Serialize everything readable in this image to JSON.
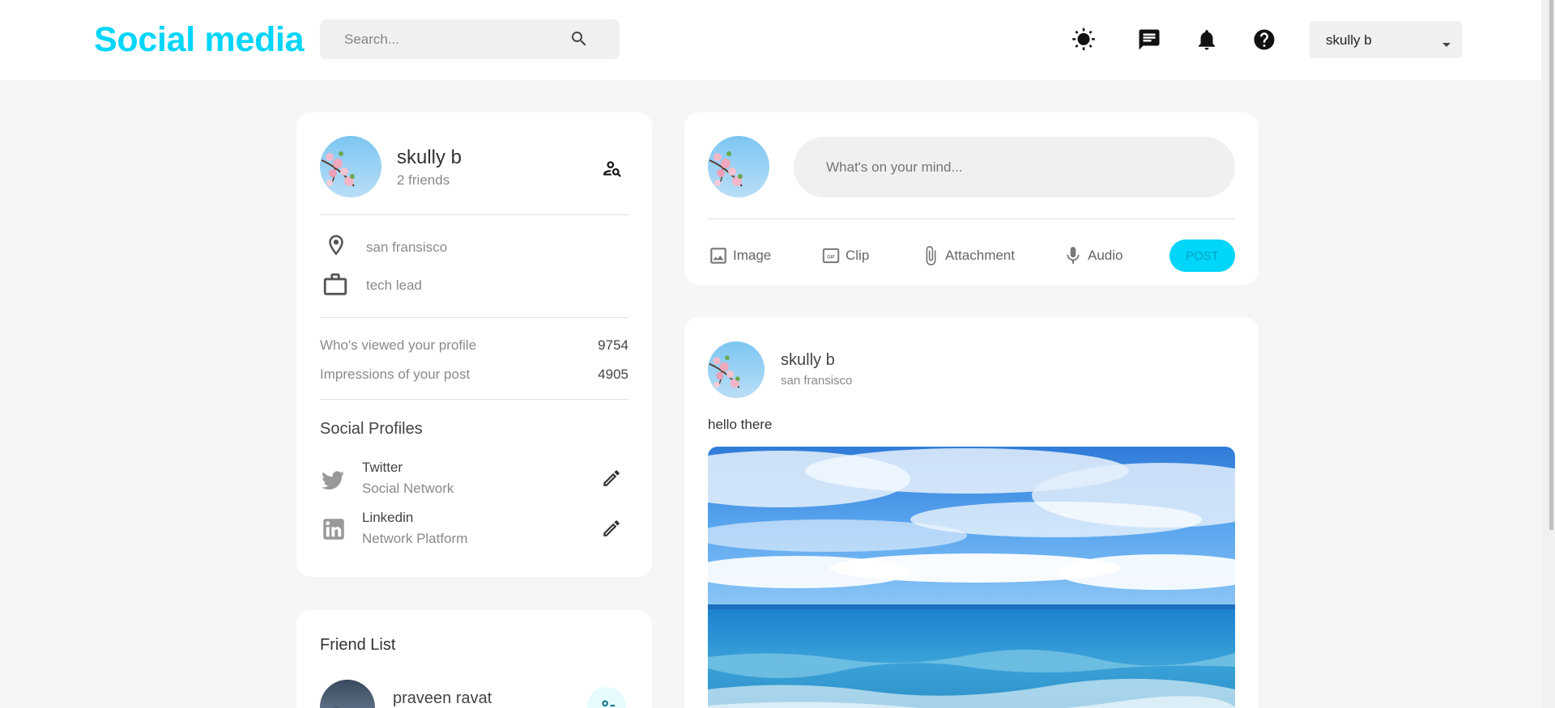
{
  "navbar": {
    "logo": "Social media",
    "search_placeholder": "Search...",
    "user_name": "skully b"
  },
  "colors": {
    "brand": "#00d5fa",
    "page_background": "#f6f6f6",
    "card_background": "#ffffff"
  },
  "icons": {
    "search": "search-icon",
    "theme": "sun-icon",
    "messages": "message-icon",
    "notifications": "bell-icon",
    "help": "help-icon",
    "caret": "caret-down-icon"
  },
  "profile": {
    "name": "skully b",
    "friends": "2 friends",
    "location": "san fransisco",
    "occupation": "tech lead",
    "stats": [
      {
        "label": "Who's viewed your profile",
        "value": "9754"
      },
      {
        "label": "Impressions of your post",
        "value": "4905"
      }
    ],
    "social_title": "Social Profiles",
    "socials": [
      {
        "name": "Twitter",
        "type": "Social Network"
      },
      {
        "name": "Linkedin",
        "type": "Network Platform"
      }
    ]
  },
  "friend_list": {
    "title": "Friend List",
    "friends": [
      {
        "name": "praveen ravat"
      }
    ]
  },
  "composer": {
    "placeholder": "What's on your mind...",
    "actions": [
      {
        "label": "Image"
      },
      {
        "label": "Clip"
      },
      {
        "label": "Attachment"
      },
      {
        "label": "Audio"
      }
    ],
    "post_label": "POST"
  },
  "post": {
    "author": "skully b",
    "location": "san fransisco",
    "text": "hello there"
  }
}
